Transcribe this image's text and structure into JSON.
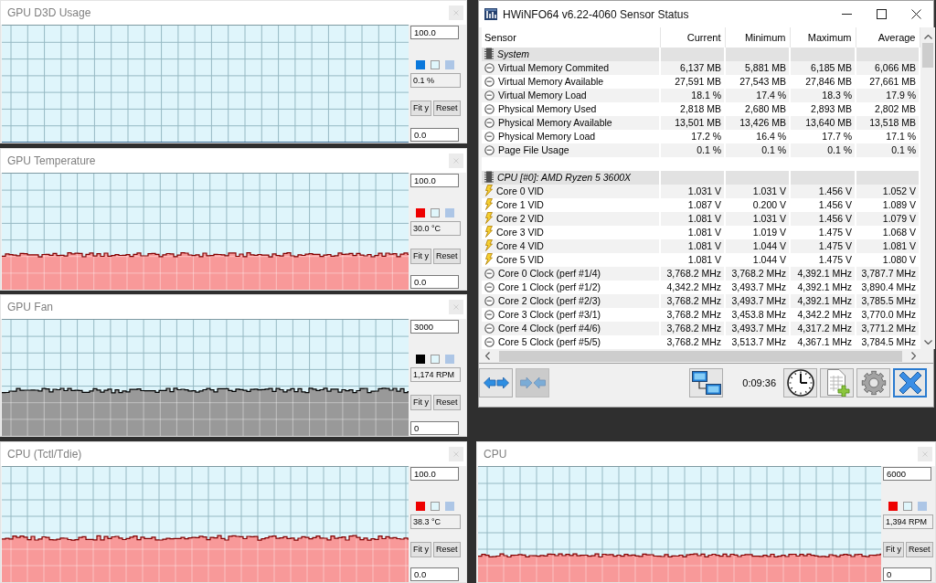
{
  "graph_windows": [
    {
      "title": "GPU D3D Usage",
      "color": "#0a78dc",
      "max_value": "100.0",
      "reading": "0.1 %",
      "min_value": "0.0",
      "fit_button": "Fit y",
      "reset_button": "Reset"
    },
    {
      "title": "GPU Temperature",
      "color": "#ee0000",
      "max_value": "100.0",
      "reading": "30.0 °C",
      "min_value": "0.0",
      "fit_button": "Fit y",
      "reset_button": "Reset"
    },
    {
      "title": "GPU Fan",
      "color": "#000000",
      "max_value": "3000",
      "reading": "1,174 RPM",
      "min_value": "0",
      "fit_button": "Fit y",
      "reset_button": "Reset"
    },
    {
      "title": "CPU (Tctl/Tdie)",
      "color": "#ee0000",
      "max_value": "100.0",
      "reading": "38.3 °C",
      "min_value": "0.0",
      "fit_button": "Fit y",
      "reset_button": "Reset"
    },
    {
      "title": "CPU",
      "color": "#ee0000",
      "max_value": "6000",
      "reading": "1,394 RPM",
      "min_value": "0",
      "fit_button": "Fit y",
      "reset_button": "Reset"
    }
  ],
  "sensor_window": {
    "title": "HWiNFO64 v6.22-4060 Sensor Status",
    "columns": [
      "Sensor",
      "Current",
      "Minimum",
      "Maximum",
      "Average"
    ],
    "groups": [
      {
        "name": "System",
        "rows": [
          {
            "kind": "gauge",
            "name": "Virtual Memory Commited",
            "values": [
              "6,137 MB",
              "5,881 MB",
              "6,185 MB",
              "6,066 MB"
            ]
          },
          {
            "kind": "gauge",
            "name": "Virtual Memory Available",
            "values": [
              "27,591 MB",
              "27,543 MB",
              "27,846 MB",
              "27,661 MB"
            ]
          },
          {
            "kind": "gauge",
            "name": "Virtual Memory Load",
            "values": [
              "18.1 %",
              "17.4 %",
              "18.3 %",
              "17.9 %"
            ]
          },
          {
            "kind": "gauge",
            "name": "Physical Memory Used",
            "values": [
              "2,818 MB",
              "2,680 MB",
              "2,893 MB",
              "2,802 MB"
            ]
          },
          {
            "kind": "gauge",
            "name": "Physical Memory Available",
            "values": [
              "13,501 MB",
              "13,426 MB",
              "13,640 MB",
              "13,518 MB"
            ]
          },
          {
            "kind": "gauge",
            "name": "Physical Memory Load",
            "values": [
              "17.2 %",
              "16.4 %",
              "17.7 %",
              "17.1 %"
            ]
          },
          {
            "kind": "gauge",
            "name": "Page File Usage",
            "values": [
              "0.1 %",
              "0.1 %",
              "0.1 %",
              "0.1 %"
            ]
          }
        ]
      },
      {
        "name": "CPU [#0]: AMD Ryzen 5 3600X",
        "rows": [
          {
            "kind": "voltage",
            "name": "Core 0 VID",
            "values": [
              "1.031 V",
              "1.031 V",
              "1.456 V",
              "1.052 V"
            ]
          },
          {
            "kind": "voltage",
            "name": "Core 1 VID",
            "values": [
              "1.087 V",
              "0.200 V",
              "1.456 V",
              "1.089 V"
            ]
          },
          {
            "kind": "voltage",
            "name": "Core 2 VID",
            "values": [
              "1.081 V",
              "1.031 V",
              "1.456 V",
              "1.079 V"
            ]
          },
          {
            "kind": "voltage",
            "name": "Core 3 VID",
            "values": [
              "1.081 V",
              "1.019 V",
              "1.475 V",
              "1.068 V"
            ]
          },
          {
            "kind": "voltage",
            "name": "Core 4 VID",
            "values": [
              "1.081 V",
              "1.044 V",
              "1.475 V",
              "1.081 V"
            ]
          },
          {
            "kind": "voltage",
            "name": "Core 5 VID",
            "values": [
              "1.081 V",
              "1.044 V",
              "1.475 V",
              "1.080 V"
            ]
          },
          {
            "kind": "gauge",
            "name": "Core 0 Clock (perf #1/4)",
            "values": [
              "3,768.2 MHz",
              "3,768.2 MHz",
              "4,392.1 MHz",
              "3,787.7 MHz"
            ]
          },
          {
            "kind": "gauge",
            "name": "Core 1 Clock (perf #1/2)",
            "values": [
              "4,342.2 MHz",
              "3,493.7 MHz",
              "4,392.1 MHz",
              "3,890.4 MHz"
            ]
          },
          {
            "kind": "gauge",
            "name": "Core 2 Clock (perf #2/3)",
            "values": [
              "3,768.2 MHz",
              "3,493.7 MHz",
              "4,392.1 MHz",
              "3,785.5 MHz"
            ]
          },
          {
            "kind": "gauge",
            "name": "Core 3 Clock (perf #3/1)",
            "values": [
              "3,768.2 MHz",
              "3,453.8 MHz",
              "4,342.2 MHz",
              "3,770.0 MHz"
            ]
          },
          {
            "kind": "gauge",
            "name": "Core 4 Clock (perf #4/6)",
            "values": [
              "3,768.2 MHz",
              "3,493.7 MHz",
              "4,317.2 MHz",
              "3,771.2 MHz"
            ]
          },
          {
            "kind": "gauge",
            "name": "Core 5 Clock (perf #5/5)",
            "values": [
              "3,768.2 MHz",
              "3,513.7 MHz",
              "4,367.1 MHz",
              "3,784.5 MHz"
            ]
          }
        ]
      }
    ],
    "toolbar": {
      "left": [
        {
          "kind": "expand",
          "disabled": false,
          "focused": false
        },
        {
          "kind": "collapse",
          "disabled": true,
          "focused": false
        }
      ],
      "right": [
        {
          "kind": "network",
          "disabled": false,
          "focused": false
        },
        {
          "kind": "timer",
          "text": "0:09:36"
        },
        {
          "kind": "clock",
          "disabled": false,
          "focused": false
        },
        {
          "kind": "report",
          "disabled": false,
          "focused": false
        },
        {
          "kind": "settings",
          "disabled": false,
          "focused": false
        },
        {
          "kind": "close",
          "disabled": false,
          "focused": true
        }
      ]
    }
  }
}
